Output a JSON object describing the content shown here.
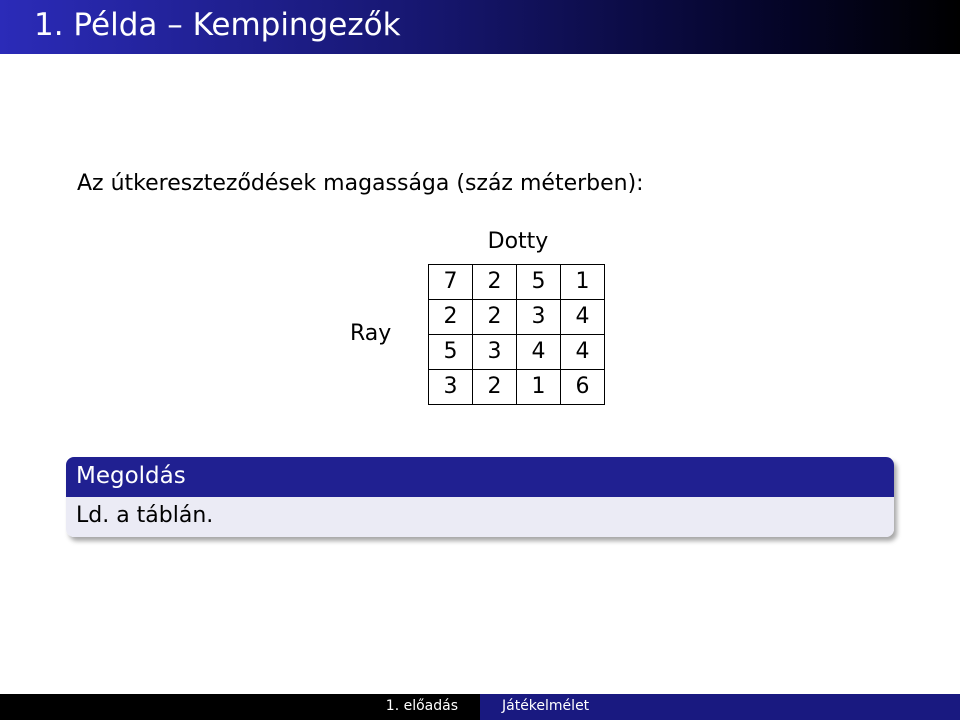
{
  "header": {
    "title": "1. Példa – Kempingezők"
  },
  "content": {
    "intro": "Az útkereszteződések magassága (száz méterben):",
    "column_player": "Dotty",
    "row_player": "Ray",
    "matrix": [
      [
        "7",
        "2",
        "5",
        "1"
      ],
      [
        "2",
        "2",
        "3",
        "4"
      ],
      [
        "5",
        "3",
        "4",
        "4"
      ],
      [
        "3",
        "2",
        "1",
        "6"
      ]
    ]
  },
  "solution_block": {
    "title": "Megoldás",
    "text": "Ld. a táblán."
  },
  "footer": {
    "left": "1. előadás",
    "right": "Játékelmélet"
  },
  "colors": {
    "title_bar": "#2b2bb8",
    "block_header": "#202091",
    "block_body": "#ebebf5",
    "footer_right": "#191980"
  }
}
